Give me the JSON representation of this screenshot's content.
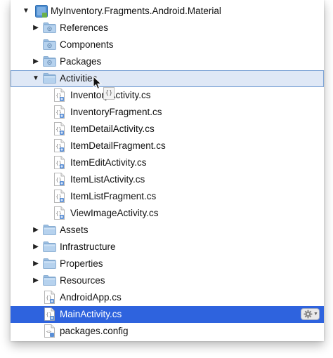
{
  "tree": {
    "project": {
      "label": "MyInventory.Fragments.Android.Material"
    },
    "references": {
      "label": "References"
    },
    "components": {
      "label": "Components"
    },
    "packages": {
      "label": "Packages"
    },
    "activities": {
      "label": "Activities",
      "files": [
        "InventoryActivity.cs",
        "InventoryFragment.cs",
        "ItemDetailActivity.cs",
        "ItemDetailFragment.cs",
        "ItemEditActivity.cs",
        "ItemListActivity.cs",
        "ItemListFragment.cs",
        "ViewImageActivity.cs"
      ]
    },
    "assets": {
      "label": "Assets"
    },
    "infrastructure": {
      "label": "Infrastructure"
    },
    "properties": {
      "label": "Properties"
    },
    "resources": {
      "label": "Resources"
    },
    "android_app": {
      "label": "AndroidApp.cs"
    },
    "main_activity": {
      "label": "MainActivity.cs"
    },
    "packages_config": {
      "label": "packages.config"
    }
  },
  "drag_ghost": {
    "glyph": "{}"
  },
  "colors": {
    "selection": "#2e63de",
    "hover_background": "#dfe8f6",
    "hover_border": "#7fa5d6",
    "folder": "#a9c9e8",
    "project_icon": "#4f8fd1"
  },
  "icons": {
    "expanded": "disclosure-triangle-down-icon",
    "collapsed": "disclosure-triangle-right-icon",
    "folder": "folder-icon",
    "special_folder": "gear-folder-icon",
    "csharp_file": "csharp-file-icon",
    "config_file": "xml-file-icon",
    "action": "gear-icon"
  }
}
